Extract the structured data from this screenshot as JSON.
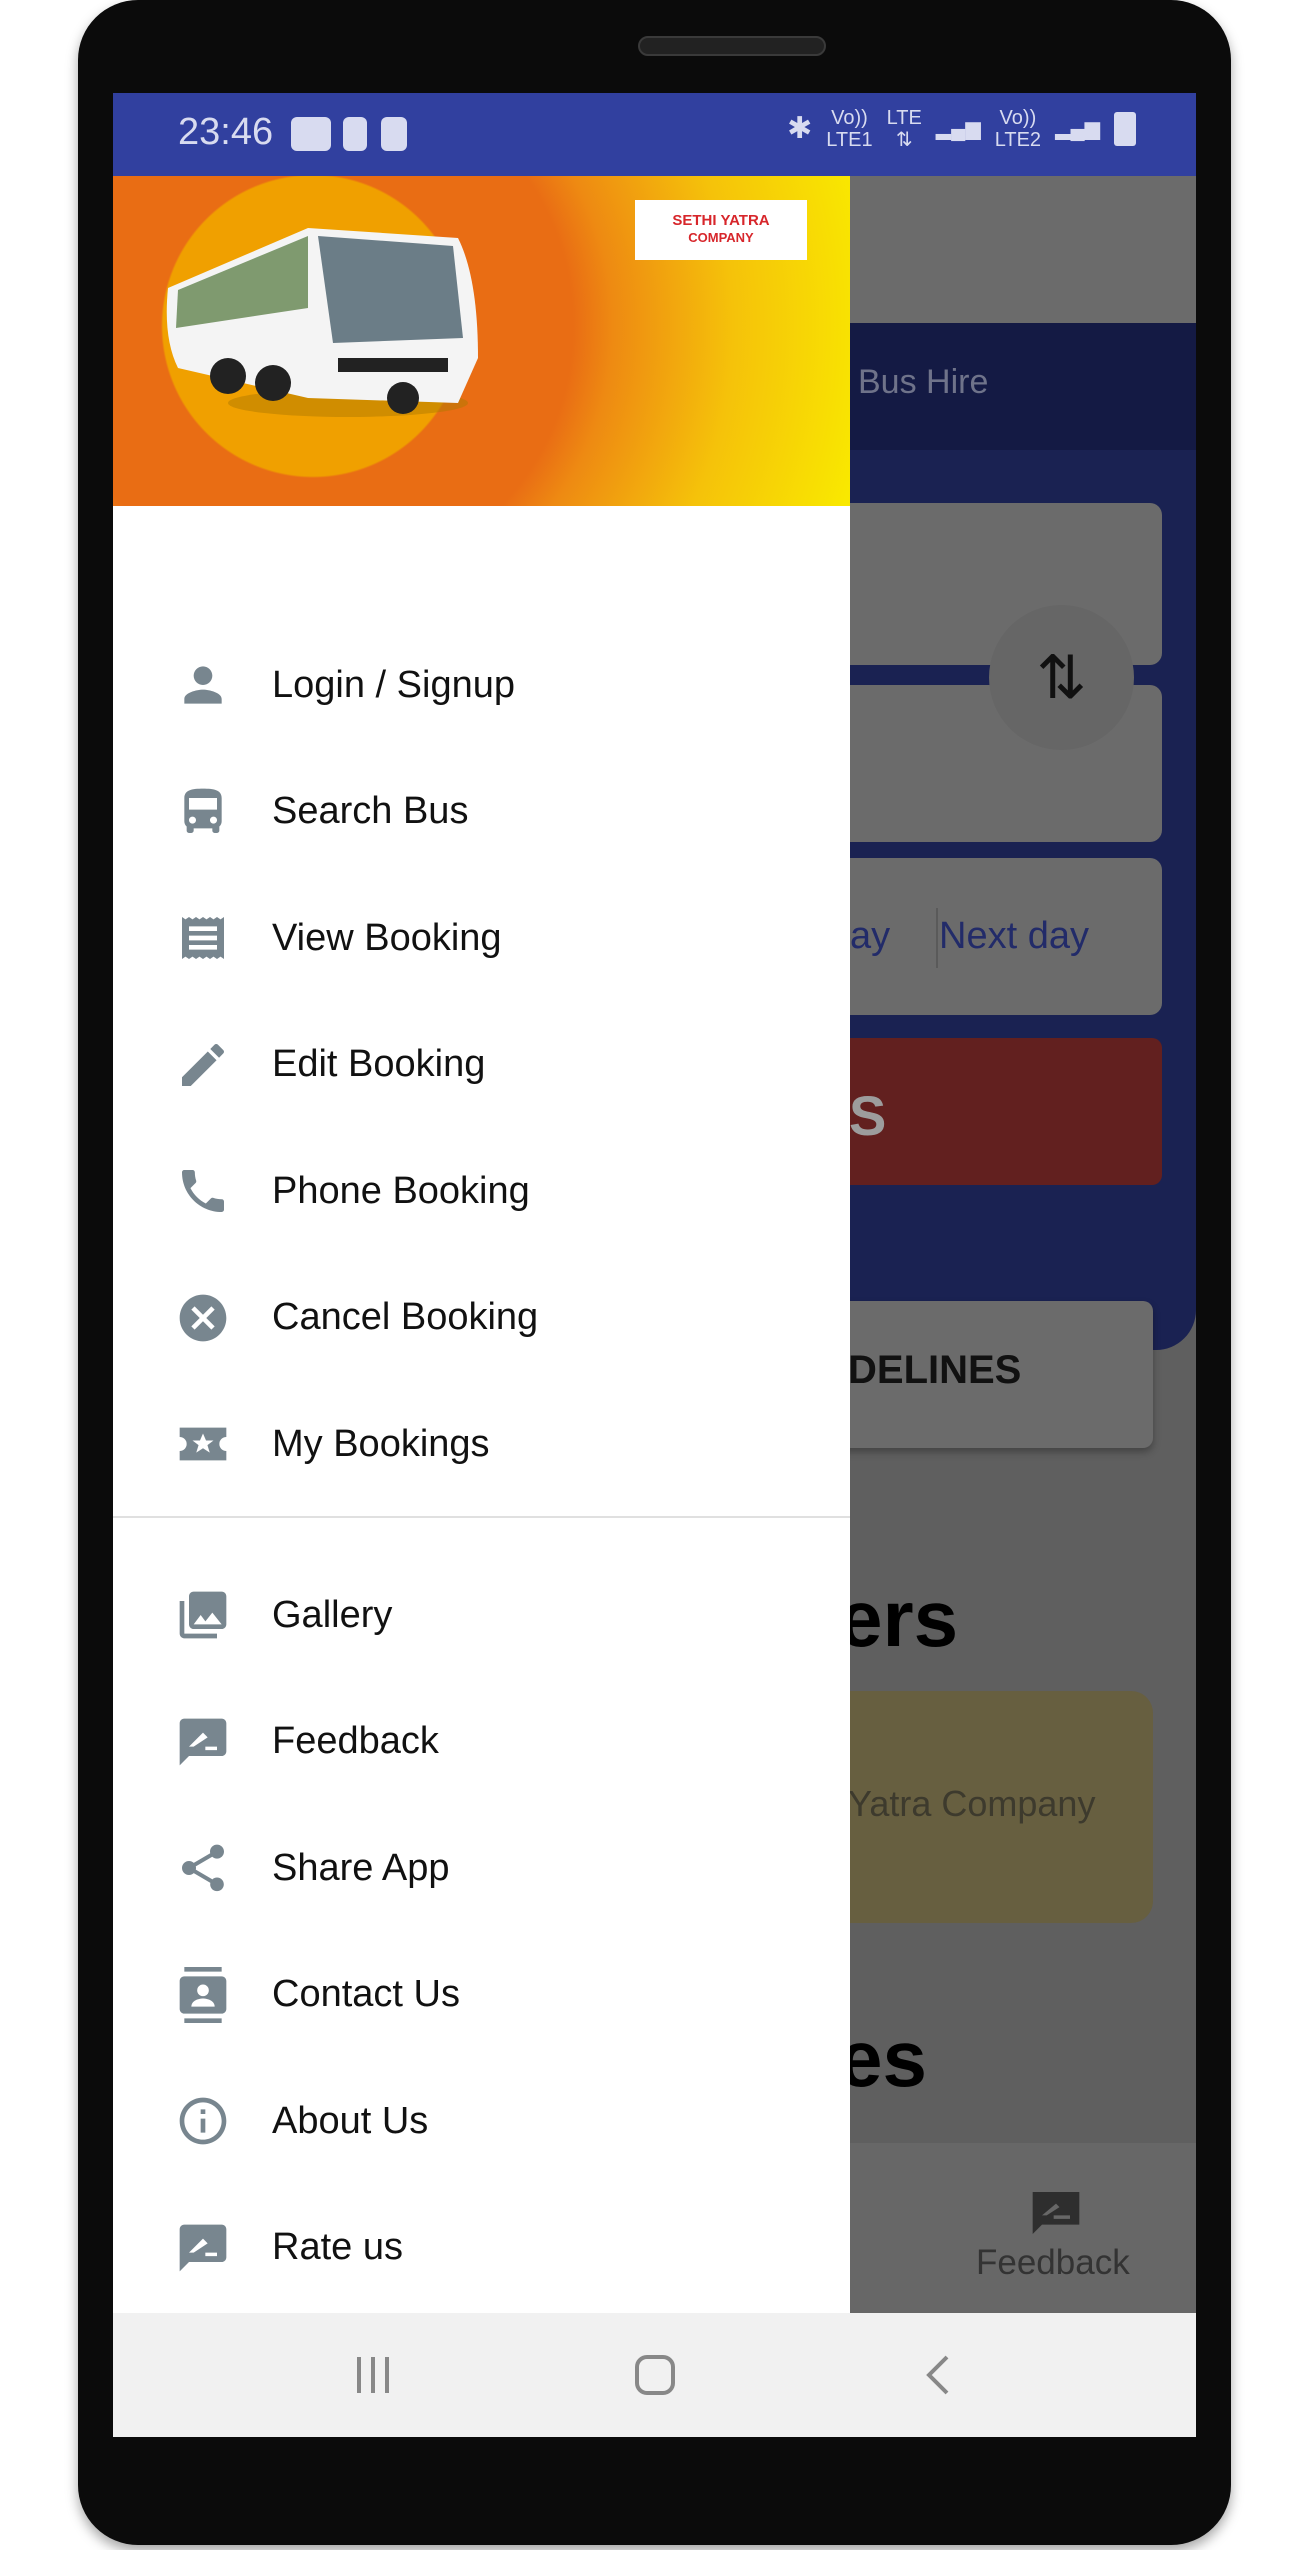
{
  "status_bar": {
    "time": "23:46",
    "icons": [
      "youtube-icon",
      "clock-icon",
      "wifi-icon"
    ],
    "right": {
      "volte1": "Vo))",
      "lte1": "LTE1",
      "lte": "LTE",
      "volte2": "Vo))",
      "lte2": "LTE2"
    }
  },
  "drawer": {
    "logo_line1": "SETHI YATRA",
    "logo_line2": "COMPANY",
    "primary_items": [
      {
        "label": "Login / Signup",
        "icon": "person"
      },
      {
        "label": "Search Bus",
        "icon": "bus"
      },
      {
        "label": "View Booking",
        "icon": "receipt"
      },
      {
        "label": "Edit Booking",
        "icon": "edit"
      },
      {
        "label": "Phone Booking",
        "icon": "phone"
      },
      {
        "label": "Cancel Booking",
        "icon": "cancel"
      },
      {
        "label": "My Bookings",
        "icon": "ticket-star"
      }
    ],
    "secondary_items": [
      {
        "label": "Gallery",
        "icon": "gallery"
      },
      {
        "label": "Feedback",
        "icon": "rate-review"
      },
      {
        "label": "Share App",
        "icon": "share"
      },
      {
        "label": "Contact Us",
        "icon": "contact"
      },
      {
        "label": "About Us",
        "icon": "info"
      },
      {
        "label": "Rate us",
        "icon": "rate-review"
      }
    ]
  },
  "background": {
    "tab_label": "Bus Hire",
    "today_fragment": "ay",
    "next_day": "Next day",
    "search_fragment": "S",
    "guidelines_fragment": "DELINES",
    "heading1_fragment": "ers",
    "card_text": "Yatra Company",
    "heading2_fragment": "es",
    "bottom_nav_feedback": "Feedback"
  },
  "colors": {
    "status_bar": "#31409f",
    "icon": "#78868f",
    "header_orange": "#e96d14",
    "header_yellow": "#f9e800"
  }
}
